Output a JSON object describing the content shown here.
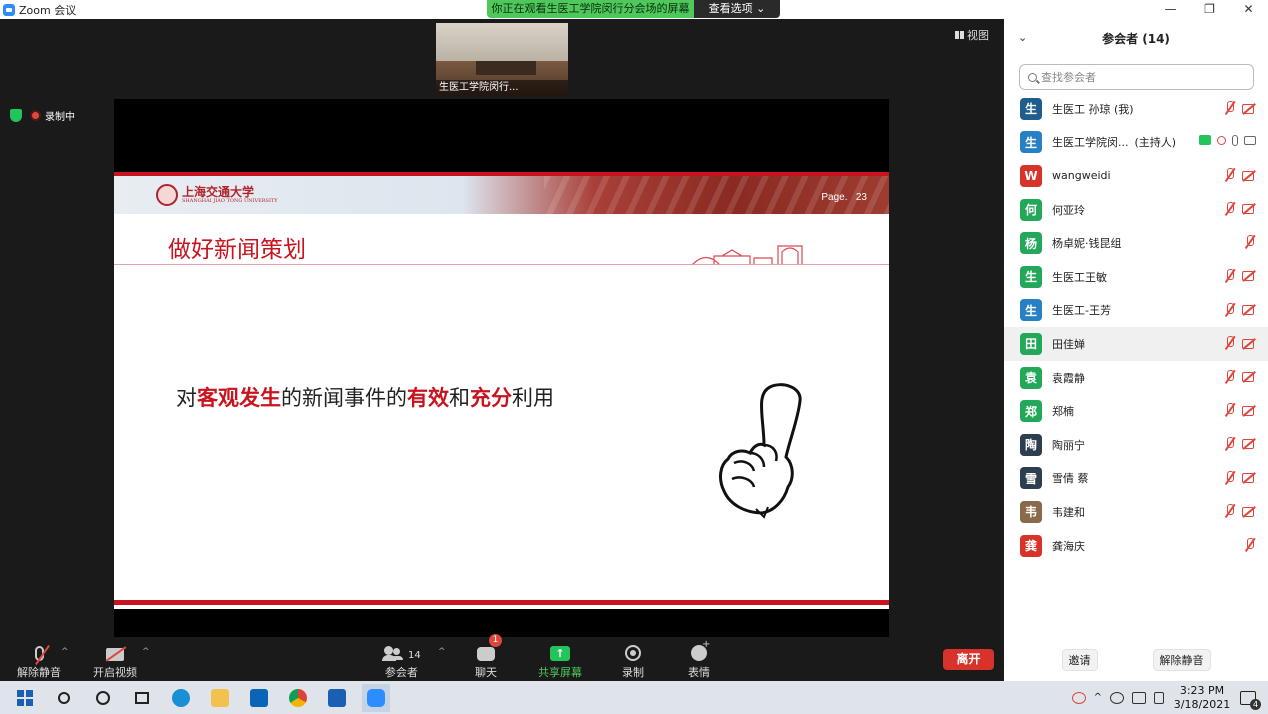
{
  "window": {
    "title": "Zoom 会议",
    "controls": [
      "—",
      "❐",
      "✕"
    ]
  },
  "banner": {
    "message": "你正在观看生医工学院闵行分会场的屏幕",
    "options_label": "查看选项 ⌄"
  },
  "thumbnail": {
    "name": "生医工学院闵行..."
  },
  "view_button": {
    "label": "视图"
  },
  "recording": {
    "label": "录制中"
  },
  "slide": {
    "school": "上海交通大学",
    "school_sub": "SHANGHAI JIAO TONG UNIVERSITY",
    "page_label": "Page.",
    "page_number": "23",
    "title": "做好新闻策划",
    "body": {
      "p1": "对",
      "h1": "客观发生",
      "p2": "的新闻事件的",
      "h2": "有效",
      "p3": "和",
      "h3": "充分",
      "p4": "利用"
    }
  },
  "toolbar": {
    "unmute": "解除静音",
    "start_video": "开启视频",
    "participants": "参会者",
    "participants_count": "14",
    "chat": "聊天",
    "chat_badge": "1",
    "share": "共享屏幕",
    "record": "录制",
    "reactions": "表情",
    "leave": "离开"
  },
  "panel": {
    "title": "参会者 (14)",
    "search_placeholder": "查找参会者",
    "participants": [
      {
        "initial": "生",
        "color": "#1f5d8c",
        "name": "生医工 孙琼 (我)",
        "role": "",
        "icons": [
          "mic-off",
          "cam-off"
        ]
      },
      {
        "initial": "生",
        "color": "#2680c2",
        "name": "生医工学院闵...",
        "role": "(主持人)",
        "icons": [
          "screen",
          "rec",
          "mic-on",
          "cam-on"
        ]
      },
      {
        "initial": "W",
        "color": "#d7332a",
        "name": "wangweidi",
        "role": "",
        "icons": [
          "mic-off",
          "cam-off"
        ]
      },
      {
        "initial": "何",
        "color": "#23a85a",
        "name": "何亚玲",
        "role": "",
        "icons": [
          "mic-off",
          "cam-off"
        ]
      },
      {
        "initial": "杨",
        "color": "#23a85a",
        "name": "杨卓妮·钱昆组",
        "role": "",
        "icons": [
          "mic-off"
        ]
      },
      {
        "initial": "生",
        "color": "#23a85a",
        "name": "生医工王敏",
        "role": "",
        "icons": [
          "mic-off",
          "cam-off"
        ]
      },
      {
        "initial": "生",
        "color": "#2680c2",
        "name": "生医工-王芳",
        "role": "",
        "icons": [
          "mic-off",
          "cam-off"
        ]
      },
      {
        "initial": "田",
        "color": "#23a85a",
        "name": "田佳婵",
        "role": "",
        "icons": [
          "mic-off",
          "cam-off"
        ]
      },
      {
        "initial": "袁",
        "color": "#23a85a",
        "name": "袁霞静",
        "role": "",
        "icons": [
          "mic-off",
          "cam-off"
        ]
      },
      {
        "initial": "郑",
        "color": "#23a85a",
        "name": "郑楠",
        "role": "",
        "icons": [
          "mic-off",
          "cam-off"
        ]
      },
      {
        "initial": "陶",
        "color": "#2c3e50",
        "name": "陶丽宁",
        "role": "",
        "icons": [
          "mic-off",
          "cam-off"
        ]
      },
      {
        "initial": "雪",
        "color": "#2c3e50",
        "name": "雪倩 蔡",
        "role": "",
        "icons": [
          "mic-off",
          "cam-off"
        ]
      },
      {
        "initial": "韦",
        "color": "#8a6a4a",
        "name": "韦建和",
        "role": "",
        "icons": [
          "mic-off",
          "cam-off"
        ]
      },
      {
        "initial": "龚",
        "color": "#d7332a",
        "name": "龚海庆",
        "role": "",
        "icons": [
          "mic-off"
        ]
      }
    ],
    "invite": "邀请",
    "unmute_all": "解除静音"
  },
  "taskbar": {
    "time": "3:23 PM",
    "date": "3/18/2021",
    "notifications": "4"
  },
  "colors": {
    "accent_red": "#c8141e",
    "zoom_green": "#23c45a",
    "leave_red": "#d7332a"
  }
}
